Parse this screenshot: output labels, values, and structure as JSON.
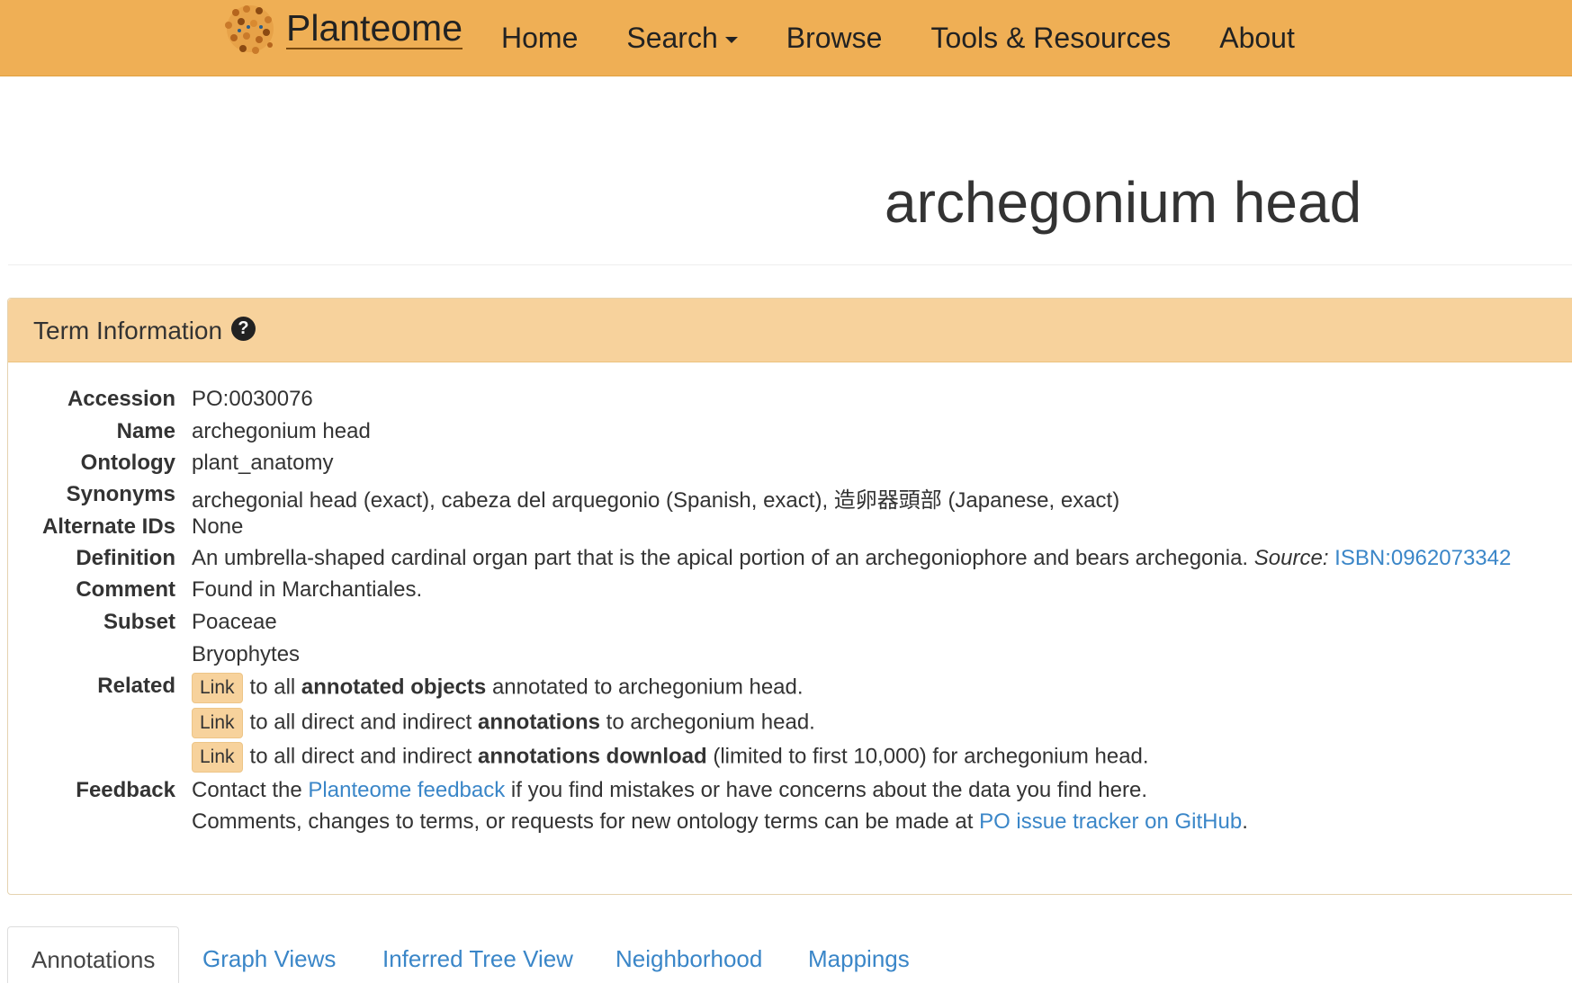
{
  "navbar": {
    "brand": "Planteome",
    "items": [
      {
        "label": "Home"
      },
      {
        "label": "Search"
      },
      {
        "label": "Browse"
      },
      {
        "label": "Tools & Resources"
      },
      {
        "label": "About"
      }
    ]
  },
  "page": {
    "title": "archegonium head"
  },
  "term_panel": {
    "heading": "Term Information",
    "help_icon": "?",
    "labels": {
      "accession": "Accession",
      "name": "Name",
      "ontology": "Ontology",
      "synonyms": "Synonyms",
      "alternate_ids": "Alternate IDs",
      "definition": "Definition",
      "comment": "Comment",
      "subset": "Subset",
      "related": "Related",
      "feedback": "Feedback"
    },
    "accession": "PO:0030076",
    "name": "archegonium head",
    "ontology": "plant_anatomy",
    "synonyms": "archegonial head (exact), cabeza del arquegonio (Spanish, exact), 造卵器頭部 (Japanese, exact)",
    "alternate_ids": "None",
    "definition": {
      "text": "An umbrella-shaped cardinal organ part that is the apical portion of an archegoniophore and bears archegonia.",
      "source_label": "Source:",
      "source_link": "ISBN:0962073342"
    },
    "comment": "Found in Marchantiales.",
    "subsets": [
      "Poaceae",
      "Bryophytes"
    ],
    "related": [
      {
        "button": "Link",
        "pre": "to all",
        "bold": "annotated objects",
        "post": "annotated to archegonium head."
      },
      {
        "button": "Link",
        "pre": "to all direct and indirect",
        "bold": "annotations",
        "post": "to archegonium head."
      },
      {
        "button": "Link",
        "pre": "to all direct and indirect",
        "bold": "annotations download",
        "post": "(limited to first 10,000) for archegonium head."
      }
    ],
    "feedback": {
      "line1_pre": "Contact the",
      "line1_link": "Planteome feedback",
      "line1_post": "if you find mistakes or have concerns about the data you find here.",
      "line2_pre": "Comments, changes to terms, or requests for new ontology terms can be made at",
      "line2_link": "PO issue tracker on GitHub",
      "line2_post": "."
    }
  },
  "tabs": [
    {
      "label": "Annotations",
      "active": true
    },
    {
      "label": "Graph Views"
    },
    {
      "label": "Inferred Tree View"
    },
    {
      "label": "Neighborhood"
    },
    {
      "label": "Mappings"
    }
  ],
  "colors": {
    "navbar": "#efaf55",
    "panel_heading": "#f7d29c",
    "link": "#3a86c8"
  }
}
